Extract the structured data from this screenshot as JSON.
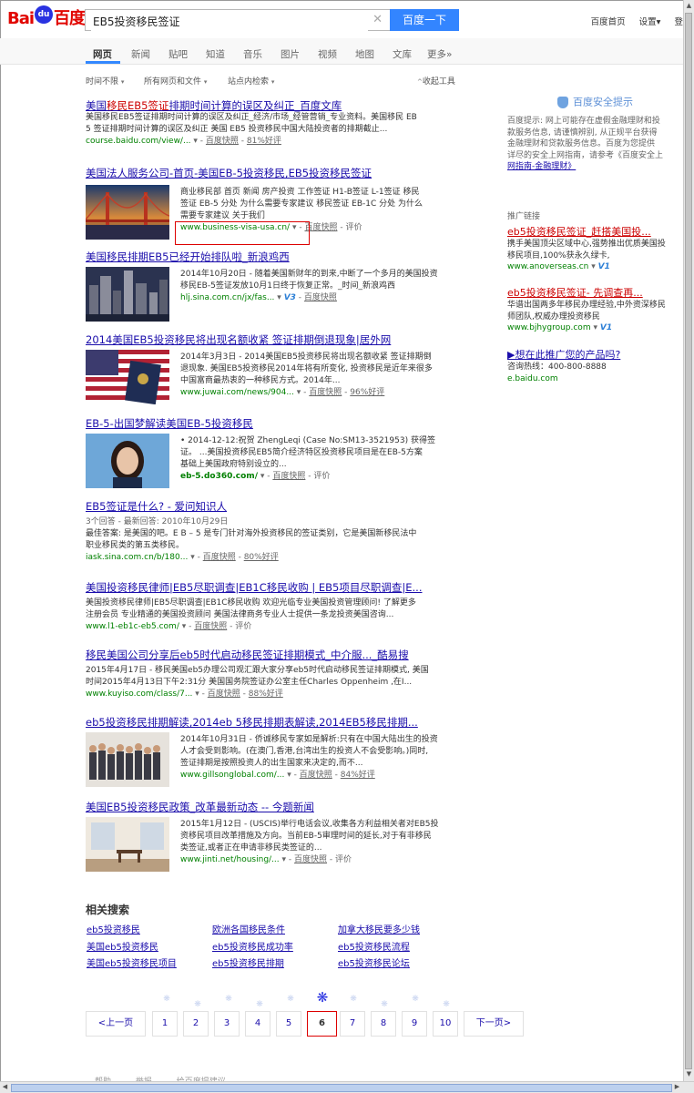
{
  "logo": {
    "left": "Bai",
    "paw": "du",
    "right": "百度"
  },
  "search": {
    "query": "EB5投资移民签证",
    "clear": "✕",
    "button": "百度一下"
  },
  "top_links": [
    "百度首页",
    "设置▾",
    "登"
  ],
  "tabs": [
    "网页",
    "新闻",
    "贴吧",
    "知道",
    "音乐",
    "图片",
    "视频",
    "地图",
    "文库",
    "更多»"
  ],
  "tools": {
    "time": "时间不限",
    "filetype": "所有网页和文件",
    "site": "站点内检索",
    "collapse": "收起工具"
  },
  "results": [
    {
      "title_pre": "美国",
      "title_em": "移民EB5签证",
      "title_post": "排期时间计算的误区及纠正_百度文库",
      "desc1": "美国移民EB5签证排期时间计算的误区及纠正_经济/市场_经管营销_专业资料。美国移民 EB",
      "desc2": "5 签证排期时间计算的误区及纠正 美国  EB5 投资移民中国大陆投资者的排期截止...",
      "url": "course.baidu.com/view/...",
      "extra": "百度快照",
      "extra2": "81%好评"
    },
    {
      "title": "美国法人服务公司-首页-美国EB-5投资移民,EB5投资移民签证",
      "desc1": "商业移民部  首页  新闻  房产投资  工作签证  H1-B签证  L-1签证  移民",
      "desc2": "签证  EB-5 分处  为什么需要专家建议  移民签证  EB-1C 分处  为什么",
      "desc3": "需要专家建议  关于我们",
      "url": "www.business-visa-usa.cn/",
      "extra": "百度快照",
      "extra2": "评价"
    },
    {
      "title": "美国移民排期EB5已经开始排队啦_新浪鸡西",
      "desc1": "2014年10月20日 - 随着美国新财年的到来,中断了一个多月的美国投资",
      "desc2": "移民EB-5签证发放10月1日终于恢复正常。_时间_新浪鸡西",
      "url": "hlj.sina.com.cn/jx/fas...",
      "v": "V3",
      "extra": "百度快照"
    },
    {
      "title": "2014美国EB5投资移民将出现名额收紧 签证排期倒退现象|居外网",
      "desc1": "2014年3月3日 - 2014美国EB5投资移民将出现名额收紧 签证排期倒",
      "desc2": "退现象. 美国EB5投资移民2014年将有所变化, 投资移民是近年来很多",
      "desc3": "中国富商最热衷的一种移民方式。2014年...",
      "url": "www.juwai.com/news/904...",
      "extra": "百度快照",
      "extra2": "96%好评"
    },
    {
      "title": "EB-5-出国梦解读美国EB-5投资移民",
      "desc1": "• 2014-12-12:祝贺  ZhengLeqi (Case No:SM13-3521953) 获得签",
      "desc2": "证。   ...美国投资移民EB5简介经济特区投资移民项目是在EB-5方案",
      "desc3": "基础上美国政府特别设立的...",
      "url": "eb-5.do360.com/",
      "extra": "百度快照",
      "extra2": "评价"
    },
    {
      "title": "EB5签证是什么? - 爱问知识人",
      "desc0": "3个回答 - 最新回答: 2010年10月29日",
      "desc1": "最佳答案: 是美国的吧。E B – 5 是专门针对海外投资移民的签证类别，它是美国新移民法中",
      "desc2": "职业移民类的第五类移民。",
      "url": "iask.sina.com.cn/b/180...",
      "extra": "百度快照",
      "extra2": "80%好评"
    },
    {
      "title": "美国投资移民律师|EB5尽职调查|EB1C移民收购 | EB5项目尽职调查|E...",
      "desc1": "美国投资移民律师|EB5尽职调查|EB1C移民收购 欢迎光临专业美国投资管理顾问! 了解更多",
      "desc2": "注册会员  专业精通的美国投资顾问  美国法律商务专业人士提供一条龙投资美国咨询...",
      "url": "www.l1-eb1c-eb5.com/",
      "extra": "百度快照",
      "extra2": "评价"
    },
    {
      "title": "移民美国公司分享后eb5时代启动移民签证排期模式_中介服..._酷易搜",
      "desc1": "2015年4月17日 - 移民美国eb5办理公司观汇跟大家分享eb5时代启动移民签证排期模式, 美国",
      "desc2": "时间2015年4月13日下午2:31分 美国国务院签证办公室主任Charles Oppenheim ,在I...",
      "url": "www.kuyiso.com/class/7...",
      "extra": "百度快照",
      "extra2": "88%好评"
    },
    {
      "title": "eb5投资移民排期解读,2014eb 5移民排期表解读,2014EB5移民排期...",
      "desc1": "2014年10月31日 - 侨诚移民专家如是解析:只有在中国大陆出生的投资",
      "desc2": "人才会受到影响。(在澳门,香港,台湾出生的投资人不会受影响。)同时,",
      "desc3": "签证排期是按照投资人的出生国家来决定的,而不...",
      "url": "www.gillsonglobal.com/...",
      "extra": "百度快照",
      "extra2": "84%好评"
    },
    {
      "title": "美国EB5投资移民政策_改革最新动态 -- 今题新闻",
      "desc1": "2015年1月12日 - (USCIS)举行电话会议,收集各方利益相关者对EB5投",
      "desc2": "资移民项目改革措施及方向。当前EB-5审理时间的延长,对于有非移民",
      "desc3": "类签证,或者正在申请非移民类签证的...",
      "url": "www.jinti.net/housing/...",
      "extra": "百度快照",
      "extra2": "评价"
    }
  ],
  "safety": {
    "title": "百度安全提示",
    "text": [
      "百度提示: 网上可能存在虚假金融理财和投",
      "款服务信息, 请谨慎辨别, 从正规平台获得",
      "金融理财和贷款服务信息。百度为您提供",
      "详尽的安全上网指南，请参考《百度安全上",
      "网指南-金融理财》"
    ]
  },
  "ads_label": "推广链接",
  "ads": [
    {
      "title": "eb5投资移民签证_赶搭美国投...",
      "d1": "携手美国顶尖区域中心,强势推出优质美国投",
      "d2": "移民项目,100%获永久绿卡,",
      "url": "www.anoverseas.cn",
      "v": "V1"
    },
    {
      "title": "eb5投资移民签证- 先调查再...",
      "d1": "华谱出国两多年移民办理经验,中外资深移民",
      "d2": "师团队,权威办理投资移民",
      "url": "www.bjhygroup.com",
      "v": "V1"
    },
    {
      "title": "▶想在此推广您的产品吗?",
      "d1": "咨询热线：400-800-8888",
      "d2": "",
      "url": "e.baidu.com",
      "v": ""
    }
  ],
  "related": {
    "title": "相关搜索",
    "items": [
      "eb5投资移民",
      "欧洲各国移民条件",
      "加拿大移民要多少钱",
      "美国eb5投资移民",
      "eb5投资移民成功率",
      "eb5投资移民流程",
      "美国eb5投资移民项目",
      "eb5投资移民排期",
      "eb5投资移民论坛"
    ]
  },
  "pager": {
    "prev": "<上一页",
    "pages": [
      "1",
      "2",
      "3",
      "4",
      "5",
      "6",
      "7",
      "8",
      "9",
      "10"
    ],
    "current": "6",
    "next": "下一页>"
  },
  "footer": [
    "帮助",
    "举报",
    "给百度提建议"
  ]
}
